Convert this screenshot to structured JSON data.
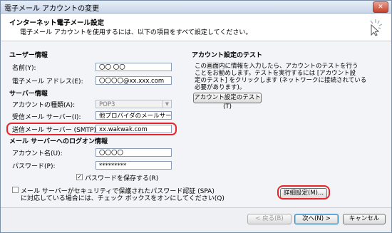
{
  "window": {
    "title": "電子メール アカウントの変更",
    "close_glyph": "✕"
  },
  "header": {
    "title": "インターネット電子メール設定",
    "subtitle": "電子メール アカウントを使用するには、以下の項目をすべて設定してください。",
    "icon": "cursor-sparkle-icon"
  },
  "user_info": {
    "section": "ユーザー情報",
    "name_label": "名前(Y):",
    "name_value": "〇〇 〇〇",
    "email_label": "電子メール アドレス(E):",
    "email_value": "〇〇〇〇@xx.xxx.com"
  },
  "server_info": {
    "section": "サーバー情報",
    "account_type_label": "アカウントの種類(A):",
    "account_type_value": "POP3",
    "incoming_label": "受信メール サーバー(I):",
    "incoming_value": "他プロバイダのメールサーバ",
    "smtp_label": "送信メール サーバー (SMTP)(O):",
    "smtp_value": "xx.wakwak.com"
  },
  "logon_info": {
    "section": "メール サーバーへのログオン情報",
    "account_label": "アカウント名(U):",
    "account_value": "〇〇〇〇",
    "password_label": "パスワード(P):",
    "password_value": "*********",
    "remember_label": "パスワードを保存する(R)",
    "remember_checked": true,
    "spa_line1": "メール サーバーがセキュリティで保護されたパスワード認証 (SPA)",
    "spa_line2": "に対応している場合には、チェック ボックスをオンにしてください(Q)",
    "spa_checked": false
  },
  "test": {
    "section": "アカウント設定のテスト",
    "lines": [
      "この画面内に情報を入力したら、アカウントのテストを行う",
      "ことをお勧めします。テストを実行するには [アカウント設",
      "定のテスト] をクリックします (ネットワークに接続されている",
      "必要があります)。"
    ],
    "button": "アカウント設定のテスト(T)"
  },
  "buttons": {
    "advanced": "詳細設定(M)...",
    "back": "< 戻る(B)",
    "next": "次へ(N) >",
    "cancel": "キャンセル"
  },
  "colors": {
    "highlight": "#e8262a",
    "title_bar": "#c9d6e8"
  }
}
